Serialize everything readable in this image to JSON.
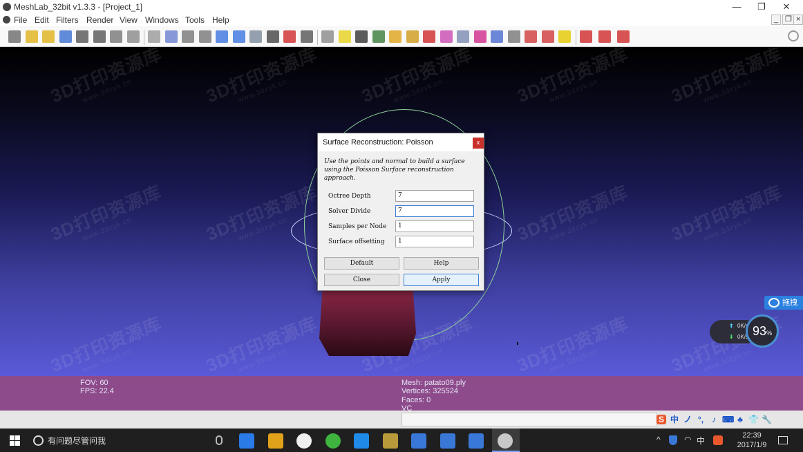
{
  "window": {
    "title": "MeshLab_32bit v1.3.3 - [Project_1]",
    "minimize": "—",
    "restore": "❐",
    "close": "✕"
  },
  "menu": {
    "items": [
      "File",
      "Edit",
      "Filters",
      "Render",
      "View",
      "Windows",
      "Tools",
      "Help"
    ],
    "mdi": {
      "minimize": "_",
      "restore": "❐",
      "close": "×"
    }
  },
  "toolbar": {
    "icons": [
      "new-project-icon",
      "open-project-icon",
      "open-file-icon",
      "reload-icon",
      "save-icon",
      "snapshot-icon",
      "layers-icon",
      "light-icon",
      "bounding-box-icon",
      "points-icon",
      "wireframe-icon",
      "flat-lines-icon",
      "flat-icon",
      "smooth-icon",
      "texture-icon",
      "lighting-bulb-icon",
      "color-icon",
      "backface-icon",
      "trackball-icon",
      "annotate-icon",
      "raster-icon",
      "mesh-info-icon",
      "axis-icon",
      "paint-icon",
      "brush-icon",
      "pickpoints-icon",
      "align-icon",
      "measure-icon",
      "reference-icon",
      "select-vertex-icon",
      "select-face-icon",
      "select-connected-icon",
      "info-icon",
      "delete-face-icon",
      "delete-vertex-icon",
      "delete-all-icon"
    ]
  },
  "viewport": {
    "watermark_text": "3D打印资源库",
    "watermark_url": "www.3dzyk.cn"
  },
  "status": {
    "fov": "FOV: 60",
    "fps": "FPS:   22.4",
    "mesh": "Mesh: patato09.ply",
    "vertices": "Vertices: 325524",
    "faces": "Faces: 0",
    "vc": "VC"
  },
  "dialog": {
    "title": "Surface Reconstruction: Poisson",
    "close": "x",
    "description": "Use the points and normal to build a surface using the Poisson Surface reconstruction approach.",
    "fields": [
      {
        "label": "Octree Depth",
        "value": "7"
      },
      {
        "label": "Solver Divide",
        "value": "7"
      },
      {
        "label": "Samples per Node",
        "value": "1"
      },
      {
        "label": "Surface offsetting",
        "value": "1"
      }
    ],
    "buttons": {
      "default": "Default",
      "help": "Help",
      "close": "Close",
      "apply": "Apply"
    }
  },
  "widgets": {
    "cloud_label": "拖拽",
    "upload": "0K/s",
    "download": "0K/s",
    "gauge": "93",
    "gauge_unit": "%"
  },
  "ime": [
    "中",
    "ノ",
    "°,",
    "♪",
    "⌨",
    "♣",
    "👕",
    "🔧"
  ],
  "taskbar": {
    "search_placeholder": "有问题尽管问我",
    "apps": [
      "edge-icon",
      "file-explorer-icon",
      "qq-icon",
      "wechat-icon",
      "browser-icon",
      "app-game-icon",
      "wps-icon",
      "security-icon",
      "cloud-icon",
      "meshlab-icon"
    ],
    "tray": {
      "chevron": "^",
      "ime_lang": "中"
    },
    "time": "22:39",
    "date": "2017/1/9"
  }
}
